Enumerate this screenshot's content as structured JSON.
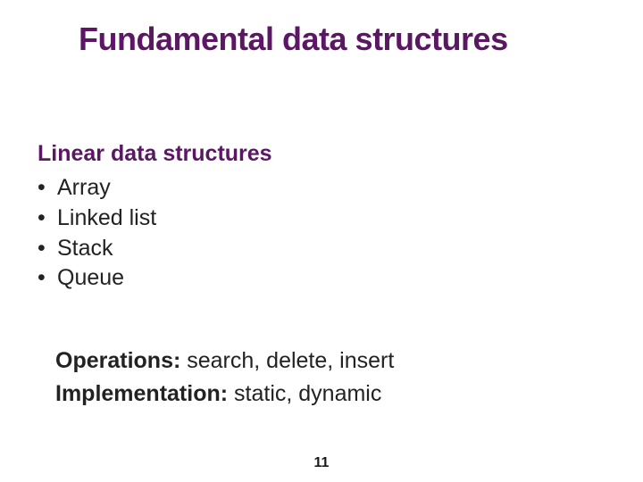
{
  "title": "Fundamental data structures",
  "section_heading": "Linear data structures",
  "bullet_symbol": "•",
  "bullets": [
    "Array",
    "Linked list",
    "Stack",
    "Queue"
  ],
  "operations": {
    "label": "Operations:",
    "text": " search, delete, insert"
  },
  "implementation": {
    "label": "Implementation:",
    "text": " static, dynamic"
  },
  "page_number": "11"
}
